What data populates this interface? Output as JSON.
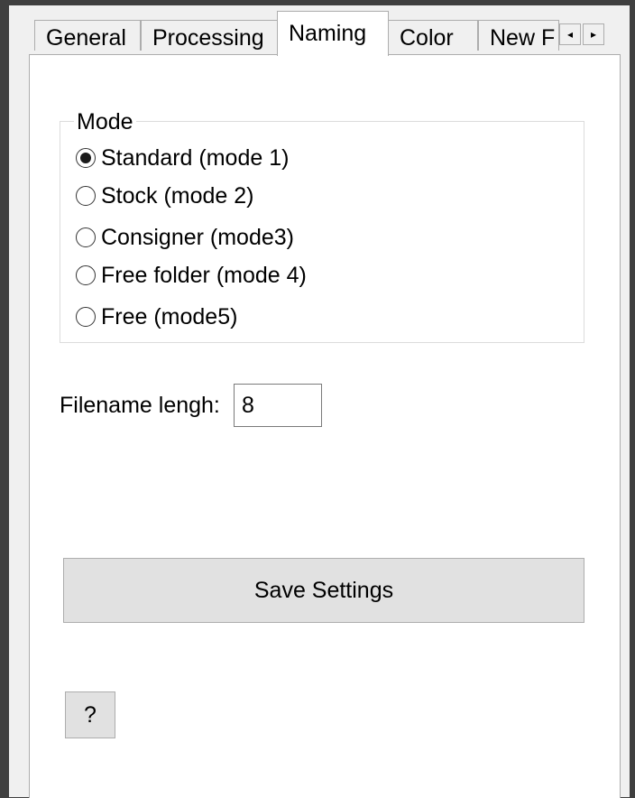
{
  "tabs": [
    {
      "label": "General",
      "active": false
    },
    {
      "label": "Processing",
      "active": false
    },
    {
      "label": "Naming",
      "active": true
    },
    {
      "label": "Color",
      "active": false
    },
    {
      "label": "New F",
      "active": false
    }
  ],
  "tab_scroll": {
    "left_icon": "arrow-left",
    "right_icon": "arrow-right",
    "left_glyph": "◂",
    "right_glyph": "▸"
  },
  "mode_group": {
    "legend": "Mode",
    "options": [
      {
        "label": "Standard (mode 1)",
        "selected": true
      },
      {
        "label": "Stock (mode 2)",
        "selected": false
      },
      {
        "label": "Consigner (mode3)",
        "selected": false
      },
      {
        "label": "Free folder (mode 4)",
        "selected": false
      },
      {
        "label": "Free (mode5)",
        "selected": false
      }
    ]
  },
  "filename_length": {
    "label": "Filename lengh:",
    "value": "8"
  },
  "save_button": {
    "label": "Save Settings"
  },
  "help_button": {
    "label": "?"
  }
}
